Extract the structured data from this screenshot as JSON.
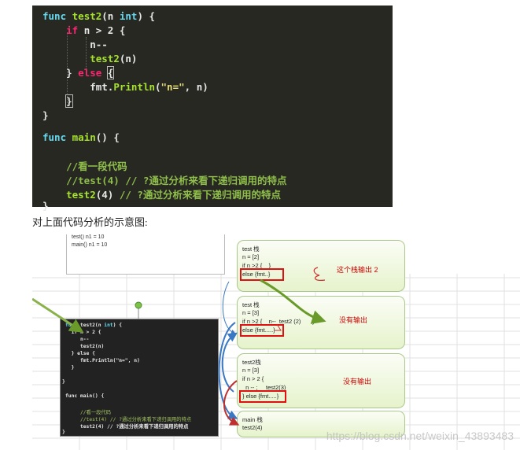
{
  "code_block": {
    "lines": [
      "func test2(n int) {",
      "    if n > 2 {",
      "        n--",
      "        test2(n)",
      "    } else {",
      "        fmt.Println(\"n=\", n)",
      "    }",
      "}",
      "",
      "func main() {",
      "",
      "    //看一段代码",
      "    //test(4) // ?通过分析来看下递归调用的特点",
      "    test2(4) // ?通过分析来看下递归调用的特点",
      "}"
    ]
  },
  "caption": "对上面代码分析的示意图:",
  "diagram": {
    "top_box": [
      "test() n1 = 10",
      "main() n1 = 10"
    ],
    "mini_code": [
      "func test2(n int) {",
      "  if n > 2 {",
      "     n--",
      "     test2(n)",
      "  } else {",
      "     fmt.Println(\"n=\", n)",
      "  }",
      "}",
      "",
      "func main() {",
      "",
      "     //看一段代码",
      "     //test(4) // ?通过分析来看下递归调用的特点",
      "     test2(4) // ?通过分析来看下递归调用的特点",
      "}"
    ],
    "frames": [
      {
        "lines": [
          "test 栈",
          "n = [2]",
          "if n >2 {    }",
          "else {fmt..}"
        ],
        "note": "这个栈输出 2"
      },
      {
        "lines": [
          "test 栈",
          "n = [3]",
          "if n >2 {    n--  test2 (2)       }",
          "else {fmt.....}"
        ],
        "note": "没有输出"
      },
      {
        "lines": [
          "test2栈",
          "n = [3]",
          "if n > 2 {",
          "  n -- ;     test2(3)",
          "} else {fmt.....}"
        ],
        "note": "没有输出"
      },
      {
        "lines": [
          "main 栈",
          "test2(4)"
        ],
        "note": ""
      }
    ],
    "watermark": "https://blog.csdn.net/weixin_43893483"
  },
  "colors": {
    "code_bg": "#272822",
    "keyword": "#66d9ef",
    "function": "#a6e22e",
    "comment": "#8fbf4a",
    "highlight": "#e01010",
    "arrow_blue": "#3a78c4",
    "arrow_green": "#6a9a2a",
    "arrow_red": "#c03030"
  }
}
